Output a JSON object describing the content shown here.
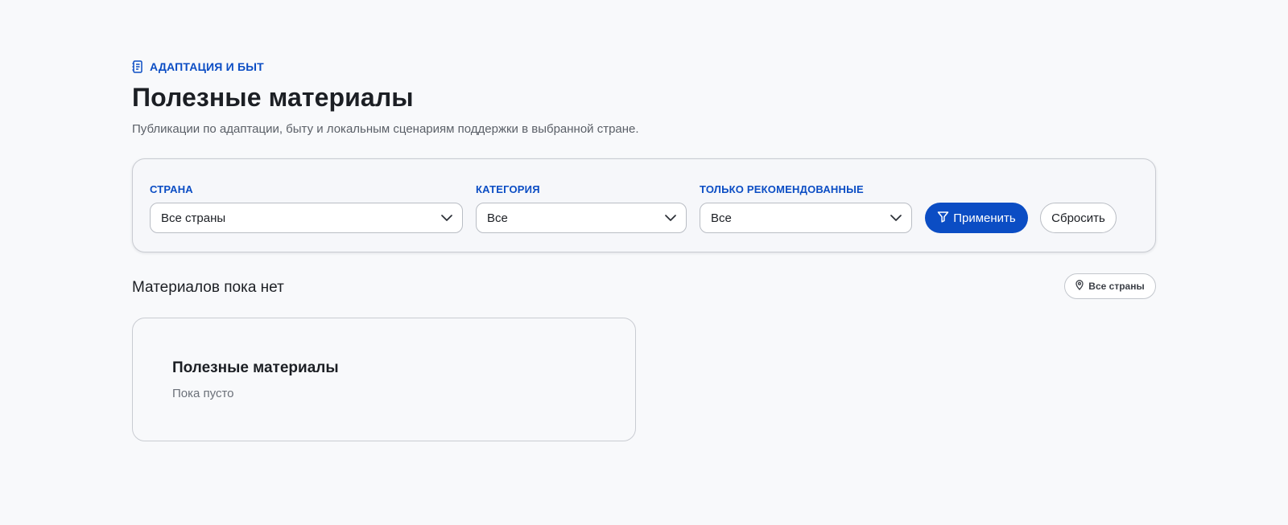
{
  "header": {
    "eyebrow": "АДАПТАЦИЯ И БЫТ",
    "eyebrow_icon": "notebook-icon",
    "title": "Полезные материалы",
    "subtitle": "Публикации по адаптации, быту и локальным сценариям поддержки в выбранной стране."
  },
  "filters": {
    "country": {
      "label": "СТРАНА",
      "value": "Все страны"
    },
    "category": {
      "label": "КАТЕГОРИЯ",
      "value": "Все"
    },
    "recommended": {
      "label": "ТОЛЬКО РЕКОМЕНДОВАННЫЕ",
      "value": "Все"
    },
    "apply_label": "Применить",
    "reset_label": "Сбросить"
  },
  "results": {
    "heading": "Материалов пока нет",
    "country_chip": "Все страны"
  },
  "empty_state": {
    "title": "Полезные материалы",
    "text": "Пока пусто"
  },
  "colors": {
    "accent": "#0b4dc4",
    "background": "#f8f9fb"
  }
}
